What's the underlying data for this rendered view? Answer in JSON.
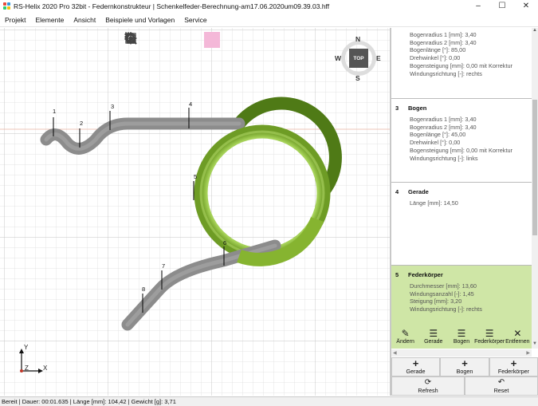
{
  "window": {
    "title": "RS-Helix 2020 Pro 32bit - Federnkonstrukteur | Schenkelfeder-Berechnung-am17.06.2020um09.39.03.hff",
    "minimize": "–",
    "maximize": "☐",
    "close": "✕"
  },
  "menu": [
    "Projekt",
    "Elemente",
    "Ansicht",
    "Beispiele und Vorlagen",
    "Service"
  ],
  "viewport": {
    "compass": {
      "n": "N",
      "s": "S",
      "w": "W",
      "e": "E",
      "top": "TOP"
    },
    "axes": {
      "y": "Y",
      "x": "X",
      "z": "Z"
    },
    "markers": [
      "1",
      "2",
      "3",
      "4",
      "5",
      "6",
      "7",
      "8"
    ],
    "toolbar": [
      "home-icon",
      "eye-icon",
      "zoom-region-icon",
      "zoom-icon",
      "pan-icon",
      "rotate-icon",
      "fit-view-icon"
    ],
    "colors": {
      "wire": "#8c8c8c",
      "coil": "#8ebd34",
      "grid": "#dcdcdc"
    }
  },
  "panel": {
    "items": [
      {
        "num": "",
        "title": "",
        "lines": [
          "Bogenradius 1 [mm]: 3,40",
          "Bogenradius 2 [mm]: 3,40",
          "Bogenlänge [°]: 85,00",
          "Drehwinkel [°]: 0,00",
          "Bogensteigung [mm]: 0,00 mit Korrektur",
          "Windungsrichtung [-]: rechts"
        ]
      },
      {
        "num": "3",
        "title": "Bogen",
        "lines": [
          "Bogenradius 1 [mm]: 3,40",
          "Bogenradius 2 [mm]: 3,40",
          "Bogenlänge [°]: 45,00",
          "Drehwinkel [°]: 0,00",
          "Bogensteigung [mm]: 0,00 mit Korrektur",
          "Windungsrichtung [-]: links"
        ]
      },
      {
        "num": "4",
        "title": "Gerade",
        "lines": [
          "Länge [mm]: 14,50"
        ]
      },
      {
        "num": "5",
        "title": "Federkörper",
        "lines": [
          "Durchmesser [mm]: 13,60",
          "Windungsanzahl [-]: 1,45",
          "Steigung [mm]: 3,20",
          "Windungsrichtung [-]: rechts"
        ]
      }
    ],
    "actions": [
      "Ändern",
      "Gerade",
      "Bogen",
      "Federkörper",
      "Entfernen"
    ],
    "buttons": {
      "add_gerade": "Gerade",
      "add_bogen": "Bogen",
      "add_federkoerper": "Federkörper",
      "refresh": "Refresh",
      "reset": "Reset",
      "plus": "+"
    },
    "accent": "#cfe6a6"
  },
  "status": "Bereit | Dauer: 00:01.635 | Länge [mm]: 104,42 | Gewicht [g]: 3,71"
}
